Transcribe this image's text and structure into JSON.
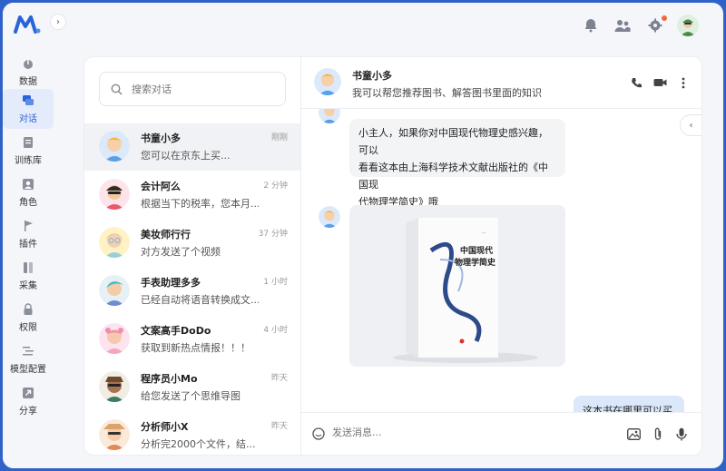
{
  "nav": {
    "items": [
      {
        "label": "数据",
        "icon": "dashboard-icon"
      },
      {
        "label": "对话",
        "icon": "chat-icon"
      },
      {
        "label": "训练库",
        "icon": "document-icon"
      },
      {
        "label": "角色",
        "icon": "user-icon"
      },
      {
        "label": "插件",
        "icon": "flag-icon"
      },
      {
        "label": "采集",
        "icon": "collect-icon"
      },
      {
        "label": "权限",
        "icon": "lock-icon"
      },
      {
        "label": "模型配置",
        "icon": "model-icon"
      },
      {
        "label": "分享",
        "icon": "share-icon"
      }
    ],
    "active_index": 1
  },
  "colors": {
    "accent": "#2b63d9",
    "frame": "#2f61c9",
    "notify": "#f0663c"
  },
  "search": {
    "placeholder": "搜索对话"
  },
  "conversations": [
    {
      "name": "书童小多",
      "preview": "您可以在京东上买...",
      "time": "刚刚"
    },
    {
      "name": "会计阿么",
      "preview": "根据当下的税率，您本月...",
      "time": "2 分钟"
    },
    {
      "name": "美妆师行行",
      "preview": "对方发送了个视频",
      "time": "37 分钟"
    },
    {
      "name": "手表助理多多",
      "preview": "已经自动将语音转换成文...",
      "time": "1 小时"
    },
    {
      "name": "文案高手DoDo",
      "preview": "获取到新热点情报！！！",
      "time": "4 小时"
    },
    {
      "name": "程序员小Mo",
      "preview": "给您发送了个思维导图",
      "time": "昨天"
    },
    {
      "name": "分析师小X",
      "preview": "分析完2000个文件，结...",
      "time": "昨天"
    }
  ],
  "chat": {
    "name": "书童小多",
    "description": "我可以帮您推荐图书、解答图书里面的知识",
    "messages": [
      {
        "line1": "小主人，如果你对中国现代物理史感兴趣，可以",
        "line2": "看看这本由上海科学技术文献出版社的《中国现",
        "line3": "代物理学简史》哦"
      },
      {
        "user": "这本书在哪里可以买到"
      }
    ],
    "book": {
      "title1": "中国现代",
      "title2": "物理学简史",
      "spine": "中国现代物理学简史"
    },
    "input_placeholder": "发送消息..."
  }
}
